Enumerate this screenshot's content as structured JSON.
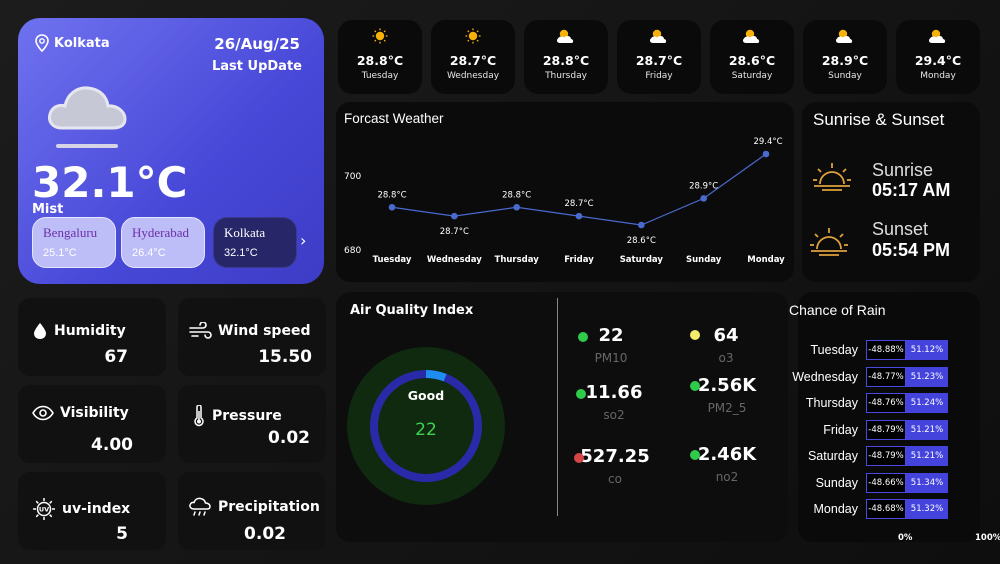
{
  "current": {
    "city": "Kolkata",
    "date": "26/Aug/25",
    "last_update_label": "Last UpDate",
    "temperature": "32.1°C",
    "condition": "Mist",
    "icon": "cloud-icon",
    "cities": [
      {
        "name": "Bengaluru",
        "temp": "25.1°C"
      },
      {
        "name": "Hyderabad",
        "temp": "26.4°C"
      },
      {
        "name": "Kolkata",
        "temp": "32.1°C"
      }
    ]
  },
  "week": [
    {
      "day": "Tuesday",
      "temp": "28.8°C",
      "icon": "sun-icon"
    },
    {
      "day": "Wednesday",
      "temp": "28.7°C",
      "icon": "sun-icon"
    },
    {
      "day": "Thursday",
      "temp": "28.8°C",
      "icon": "partly-cloudy-icon"
    },
    {
      "day": "Friday",
      "temp": "28.7°C",
      "icon": "partly-cloudy-icon"
    },
    {
      "day": "Saturday",
      "temp": "28.6°C",
      "icon": "partly-cloudy-icon"
    },
    {
      "day": "Sunday",
      "temp": "28.9°C",
      "icon": "partly-cloudy-icon"
    },
    {
      "day": "Monday",
      "temp": "29.4°C",
      "icon": "partly-cloudy-icon"
    }
  ],
  "forecast": {
    "title": "Forcast Weather"
  },
  "chart_data": {
    "type": "line",
    "title": "Forcast Weather",
    "categories": [
      "Tuesday",
      "Wednesday",
      "Thursday",
      "Friday",
      "Saturday",
      "Sunday",
      "Monday"
    ],
    "values": [
      28.8,
      28.7,
      28.8,
      28.7,
      28.6,
      28.9,
      29.4
    ],
    "labels": [
      "28.8°C",
      "28.7°C",
      "28.8°C",
      "28.7°C",
      "28.6°C",
      "28.9°C",
      "29.4°C"
    ],
    "y_ticks": [
      "700",
      "680"
    ],
    "color": "#4a6ad0"
  },
  "sun": {
    "title": "Sunrise & Sunset",
    "sunrise_label": "Sunrise",
    "sunrise": "05:17 AM",
    "sunset_label": "Sunset",
    "sunset": "05:54 PM",
    "icon_color": "#e0a13c"
  },
  "metrics": [
    {
      "label": "Humidity",
      "value": "67",
      "icon": "droplet-icon"
    },
    {
      "label": "Wind speed",
      "value": "15.50",
      "icon": "wind-icon"
    },
    {
      "label": "Visibility",
      "value": "4.00",
      "icon": "eye-icon"
    },
    {
      "label": "Pressure",
      "value": "0.02",
      "icon": "thermometer-icon"
    },
    {
      "label": "uv-index",
      "value": "5",
      "icon": "uv-icon"
    },
    {
      "label": "Precipitation",
      "value": "0.02",
      "icon": "rain-cloud-icon"
    }
  ],
  "aqi": {
    "title": "Air Quality Index",
    "status": "Good",
    "value": "22",
    "gauge_fraction": 0.06,
    "pollutants": [
      {
        "name": "PM10",
        "value": "22",
        "color": "#2fcb4a"
      },
      {
        "name": "o3",
        "value": "64",
        "color": "#f2ee6a"
      },
      {
        "name": "so2",
        "value": "11.66",
        "color": "#2fcb4a"
      },
      {
        "name": "PM2_5",
        "value": "2.56K",
        "color": "#2fcb4a"
      },
      {
        "name": "co",
        "value": "527.25",
        "color": "#d64545"
      },
      {
        "name": "no2",
        "value": "2.46K",
        "color": "#2fcb4a"
      }
    ]
  },
  "rain": {
    "title": "Chance of Rain",
    "rows": [
      {
        "day": "Tuesday",
        "neg": "-48.88%",
        "pos": "51.12%"
      },
      {
        "day": "Wednesday",
        "neg": "-48.77%",
        "pos": "51.23%"
      },
      {
        "day": "Thursday",
        "neg": "-48.76%",
        "pos": "51.24%"
      },
      {
        "day": "Friday",
        "neg": "-48.79%",
        "pos": "51.21%"
      },
      {
        "day": "Saturday",
        "neg": "-48.79%",
        "pos": "51.21%"
      },
      {
        "day": "Sunday",
        "neg": "-48.66%",
        "pos": "51.34%"
      },
      {
        "day": "Monday",
        "neg": "-48.68%",
        "pos": "51.32%"
      }
    ],
    "axis_min": "0%",
    "axis_max": "100%"
  }
}
